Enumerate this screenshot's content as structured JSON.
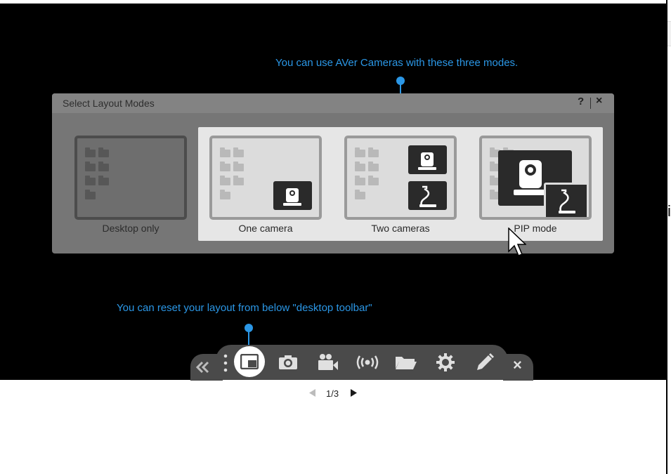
{
  "annotations": {
    "top": "You can use AVer Cameras with these three modes.",
    "bottom": "You can reset your layout from below \"desktop toolbar\""
  },
  "dialog": {
    "title": "Select Layout Modes",
    "help": "?",
    "close": "×",
    "modes": [
      {
        "label": "Desktop only",
        "icon": "desktop-only-thumbnail",
        "selected": false
      },
      {
        "label": "One camera",
        "icon": "one-camera-thumbnail",
        "selected": false
      },
      {
        "label": "Two cameras",
        "icon": "two-cameras-thumbnail",
        "selected": false
      },
      {
        "label": "PIP mode",
        "icon": "pip-mode-thumbnail",
        "selected": false
      }
    ]
  },
  "toolbar": {
    "icons": [
      "collapse-double-chevron-icon",
      "drag-handle-icon",
      "layout-icon",
      "camera-icon",
      "video-icon",
      "wireless-icon",
      "folder-icon",
      "settings-gear-icon",
      "pen-icon",
      "close-icon"
    ],
    "active": "layout-icon",
    "close": "×"
  },
  "pager": {
    "current": "1/3",
    "prev_icon": "prev-triangle-icon",
    "next_icon": "next-triangle-icon"
  },
  "edge_text": "i",
  "colors": {
    "accent": "#2b97e6",
    "toolbar": "#4a4a4a",
    "dialog": "#767676"
  }
}
